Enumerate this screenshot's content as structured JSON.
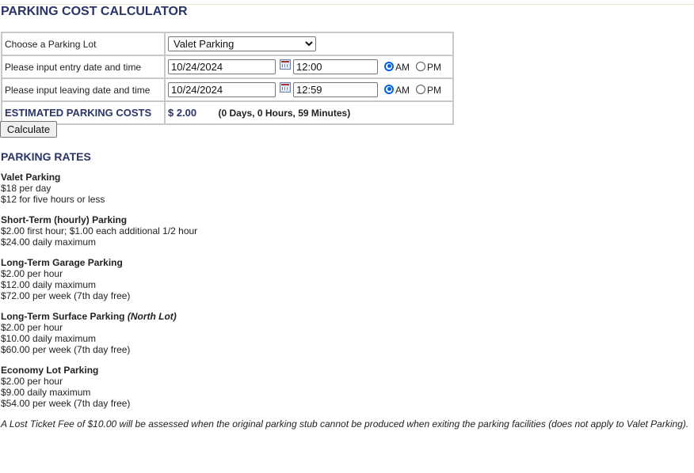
{
  "page_title": "PARKING COST CALCULATOR",
  "form": {
    "lot_label": "Choose a Parking Lot",
    "lot_selected": "Valet Parking",
    "entry_label": "Please input entry date and time",
    "entry_date": "10/24/2024",
    "entry_time": "12:00",
    "entry_ampm": "AM",
    "leave_label": "Please input leaving date and time",
    "leave_date": "10/24/2024",
    "leave_time": "12:59",
    "leave_ampm": "AM",
    "am_label": "AM",
    "pm_label": "PM",
    "est_label": "ESTIMATED PARKING COSTS",
    "est_cost": "$ 2.00",
    "est_duration": "(0 Days, 0 Hours, 59 Minutes)",
    "calculate_label": "Calculate"
  },
  "rates": {
    "heading": "PARKING RATES",
    "valet": {
      "title": "Valet Parking",
      "lines": [
        "$18 per day",
        "$12 for five hours or less"
      ]
    },
    "short_term": {
      "title": "Short-Term (hourly) Parking",
      "lines": [
        "$2.00 first hour; $1.00 each additional 1/2 hour",
        "$24.00 daily maximum"
      ]
    },
    "long_garage": {
      "title": "Long-Term Garage Parking",
      "lines": [
        "$2.00 per hour",
        "$12.00 daily maximum",
        "$72.00 per week (7th day free)"
      ]
    },
    "long_surface": {
      "title": "Long-Term Surface Parking",
      "title_suffix": "(North Lot)",
      "lines": [
        "$2.00 per hour",
        "$10.00 daily maximum",
        "$60.00 per week (7th day free)"
      ]
    },
    "economy": {
      "title": "Economy Lot Parking",
      "lines": [
        "$2.00 per hour",
        "$9.00 daily maximum",
        "$54.00 per week (7th day free)"
      ]
    },
    "note": "A Lost Ticket Fee of $10.00 will be assessed when the original parking stub cannot be produced when exiting the parking facilities (does not apply to Valet Parking)."
  },
  "icons": {
    "calendar": "calendar-icon",
    "radio_selected": "radio-selected",
    "radio_unselected": "radio-unselected"
  },
  "colors": {
    "heading": "#2b3467",
    "radio_accent": "#0060df"
  }
}
